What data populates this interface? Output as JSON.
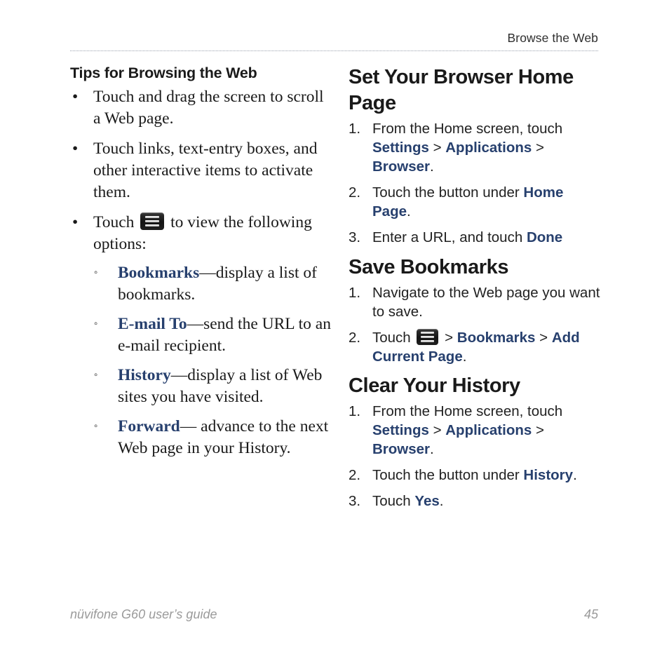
{
  "page": {
    "running_header": "Browse the Web",
    "footer_left": "nüvifone G60 user’s guide",
    "footer_page_number": "45"
  },
  "colors": {
    "accent_navy": "#27406e",
    "body_text": "#1a1a1a",
    "footer_gray": "#9a9a9a",
    "header_gray": "#2f2f2f"
  },
  "left_column": {
    "heading": "Tips for Browsing the Web",
    "bullets": [
      {
        "marker": "•",
        "text": "Touch and drag the screen to scroll a Web page."
      },
      {
        "marker": "•",
        "text": "Touch links, text-entry boxes, and other interactive items to activate them."
      },
      {
        "marker": "•",
        "text_before_icon": "Touch ",
        "icon": "menu-icon",
        "text_after_icon": " to view the following options:"
      }
    ],
    "sub_bullets": [
      {
        "marker": "◦",
        "term": "Bookmarks",
        "description": "—display a list of bookmarks."
      },
      {
        "marker": "◦",
        "term": "E-mail To",
        "description": "—send the URL to an e-mail recipient."
      },
      {
        "marker": "◦",
        "term": "History",
        "description": "—display a list of Web sites you have visited."
      },
      {
        "marker": "◦",
        "term": "Forward",
        "description": "— advance to the next Web page in your History."
      }
    ]
  },
  "right_column": {
    "sections": [
      {
        "heading": "Set Your Browser Home Page",
        "steps": [
          {
            "num": "1.",
            "parts": [
              {
                "type": "plain",
                "text": "From the Home screen, touch "
              },
              {
                "type": "keyword",
                "text": "Settings"
              },
              {
                "type": "plain",
                "text": " > "
              },
              {
                "type": "keyword",
                "text": "Applications"
              },
              {
                "type": "plain",
                "text": " > "
              },
              {
                "type": "keyword",
                "text": "Browser"
              },
              {
                "type": "plain",
                "text": "."
              }
            ]
          },
          {
            "num": "2.",
            "parts": [
              {
                "type": "plain",
                "text": "Touch the button under "
              },
              {
                "type": "keyword",
                "text": "Home Page"
              },
              {
                "type": "plain",
                "text": "."
              }
            ]
          },
          {
            "num": "3.",
            "parts": [
              {
                "type": "plain",
                "text": "Enter a URL, and touch "
              },
              {
                "type": "keyword",
                "text": "Done"
              }
            ]
          }
        ]
      },
      {
        "heading": "Save Bookmarks",
        "steps": [
          {
            "num": "1.",
            "parts": [
              {
                "type": "plain",
                "text": "Navigate to the Web page you want to save."
              }
            ]
          },
          {
            "num": "2.",
            "parts": [
              {
                "type": "plain",
                "text": "Touch "
              },
              {
                "type": "icon",
                "text": "menu-icon"
              },
              {
                "type": "plain",
                "text": " > "
              },
              {
                "type": "keyword",
                "text": "Bookmarks"
              },
              {
                "type": "plain",
                "text": " > "
              },
              {
                "type": "keyword",
                "text": "Add Current Page"
              },
              {
                "type": "plain",
                "text": "."
              }
            ]
          }
        ]
      },
      {
        "heading": "Clear Your History",
        "steps": [
          {
            "num": "1.",
            "parts": [
              {
                "type": "plain",
                "text": "From the Home screen, touch "
              },
              {
                "type": "keyword",
                "text": "Settings"
              },
              {
                "type": "plain",
                "text": " > "
              },
              {
                "type": "keyword",
                "text": "Applications"
              },
              {
                "type": "plain",
                "text": " > "
              },
              {
                "type": "keyword",
                "text": "Browser"
              },
              {
                "type": "plain",
                "text": "."
              }
            ]
          },
          {
            "num": "2.",
            "parts": [
              {
                "type": "plain",
                "text": "Touch the button under "
              },
              {
                "type": "keyword",
                "text": "History"
              },
              {
                "type": "plain",
                "text": "."
              }
            ]
          },
          {
            "num": "3.",
            "parts": [
              {
                "type": "plain",
                "text": "Touch "
              },
              {
                "type": "keyword",
                "text": "Yes"
              },
              {
                "type": "plain",
                "text": "."
              }
            ]
          }
        ]
      }
    ]
  }
}
